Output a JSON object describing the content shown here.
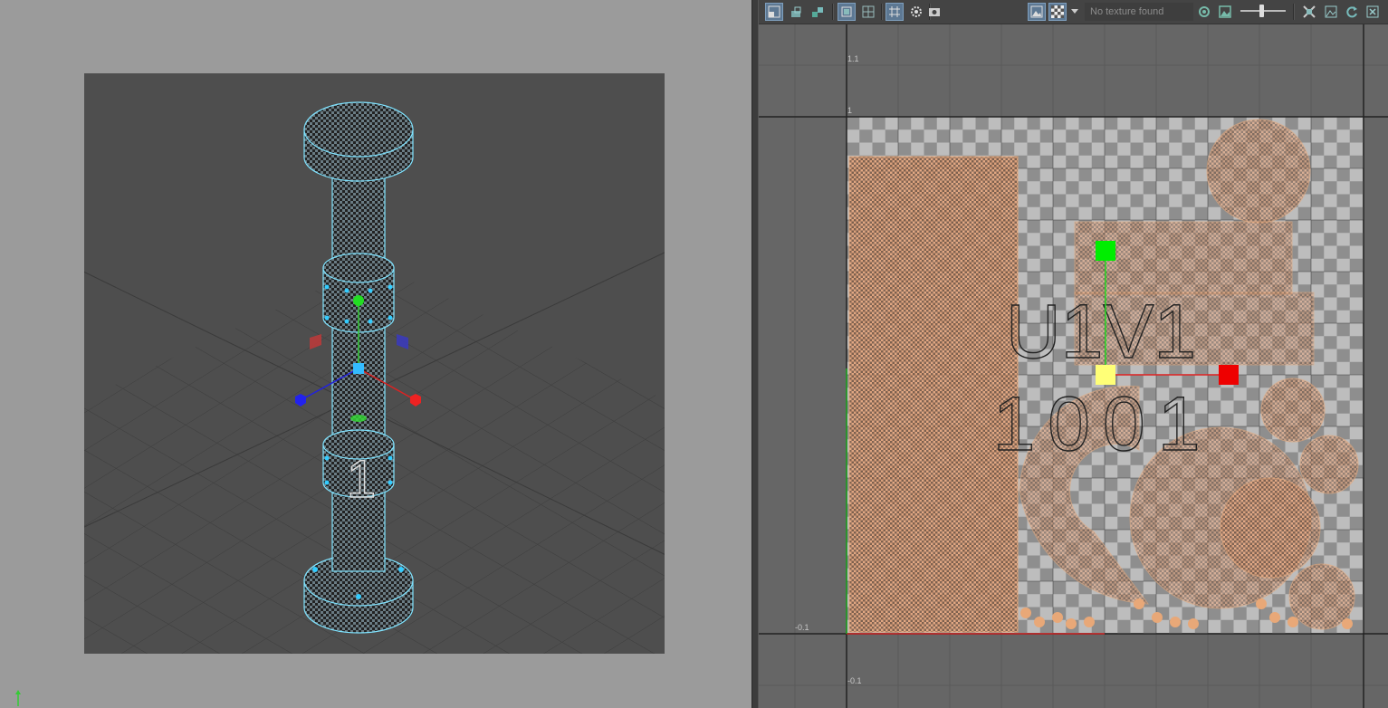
{
  "viewport": {
    "number_label": "1"
  },
  "uv_toolbar": {
    "texture_placeholder": "No texture found",
    "icons": [
      "uv-shell-select-icon",
      "uv-border-icon",
      "uv-distortion-icon",
      "shaded-uvs-icon",
      "grid-toggle-icon",
      "pixel-snap-icon",
      "filter-icon",
      "snapshot-icon",
      "display-image-icon",
      "checker-icon",
      "dropdown-icon",
      "exposure-icon",
      "image-icon",
      "slider-icon",
      "isolate-icon",
      "uv-grid-icon",
      "refresh-icon",
      "close-icon"
    ],
    "colors": {
      "active": "#5d7893"
    }
  },
  "uv_editor": {
    "tick_labels": {
      "top_v": "1.1",
      "v_one": "1",
      "neg_u": "-0.1",
      "neg_v": "-0.1"
    },
    "tile_label_line1": "U1V1",
    "tile_label_line2": "1001",
    "colors": {
      "uv_shell": "#e8a878",
      "manip_x": "#ff0000",
      "manip_y": "#00ff00",
      "manip_center": "#ffff66"
    }
  }
}
